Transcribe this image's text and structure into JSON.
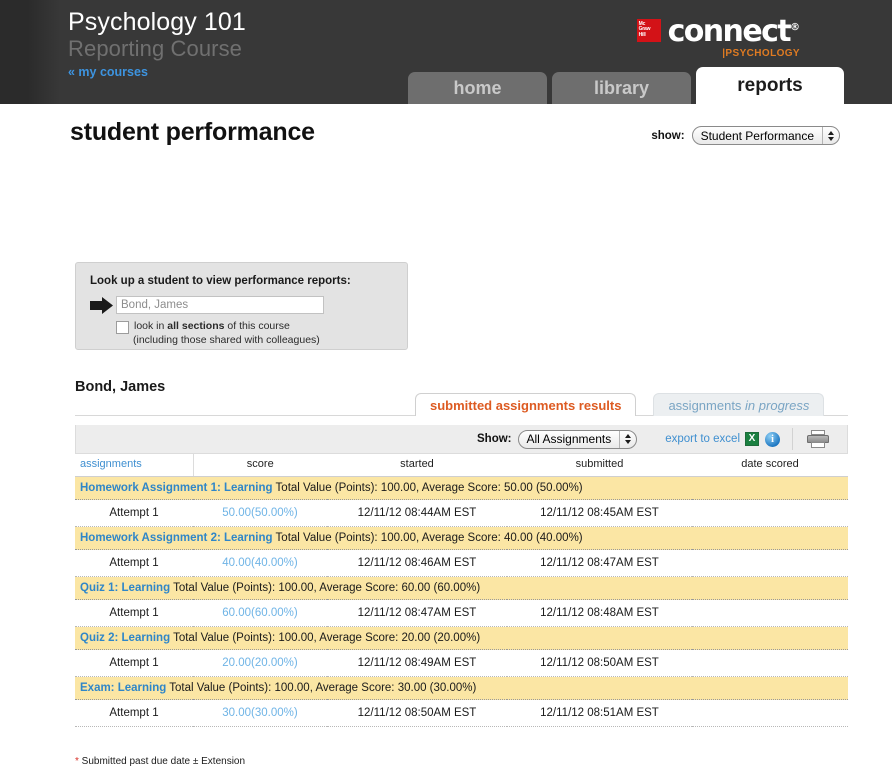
{
  "header": {
    "course_title": "Psychology 101",
    "course_subtitle": "Reporting Course",
    "my_courses_link": "« my courses",
    "brand": {
      "publisher_line1": "Mc",
      "publisher_line2": "Graw",
      "publisher_line3": "Hill",
      "name": "connect",
      "trademark": "®",
      "discipline": "|PSYCHOLOGY"
    },
    "tabs": [
      {
        "label": "home",
        "active": false
      },
      {
        "label": "library",
        "active": false
      },
      {
        "label": "reports",
        "active": true
      }
    ]
  },
  "page": {
    "title": "student performance",
    "show_label": "show:",
    "show_value": "Student Performance"
  },
  "lookup": {
    "title": "Look up a student to view performance reports:",
    "input_placeholder": "Bond, James",
    "input_value": "",
    "arrow_icon": "arrow-right-icon",
    "checkbox_checked": false,
    "checkbox_text_before": "look in ",
    "checkbox_text_bold": "all sections",
    "checkbox_text_after": " of this course",
    "checkbox_subtext": "(including those shared with colleagues)"
  },
  "student": {
    "name": "Bond, James"
  },
  "result_tabs": [
    {
      "label": "submitted assignments results",
      "active": true
    },
    {
      "label_prefix": "assignments ",
      "label_italic": "in progress",
      "active": false
    }
  ],
  "toolbar": {
    "show_label": "Show:",
    "show_value": "All Assignments",
    "export_label": "export to excel",
    "excel_icon": "excel-icon",
    "excel_icon_glyph": "X",
    "info_icon": "info-icon",
    "info_icon_glyph": "i",
    "print_icon": "printer-icon"
  },
  "table": {
    "columns": [
      "assignments",
      "score",
      "started",
      "submitted",
      "date scored"
    ],
    "rows": [
      {
        "assignment": "Homework Assignment 1: Learning",
        "summary": " Total Value (Points): 100.00, Average Score: 50.00 (50.00%)",
        "attempts": [
          {
            "attempt": "Attempt 1",
            "score": "50.00(50.00%)",
            "started": "12/11/12 08:44AM EST",
            "submitted": "12/11/12 08:45AM EST",
            "date_scored": ""
          }
        ]
      },
      {
        "assignment": "Homework Assignment 2: Learning",
        "summary": " Total Value (Points): 100.00, Average Score: 40.00 (40.00%)",
        "attempts": [
          {
            "attempt": "Attempt 1",
            "score": "40.00(40.00%)",
            "started": "12/11/12 08:46AM EST",
            "submitted": "12/11/12 08:47AM EST",
            "date_scored": ""
          }
        ]
      },
      {
        "assignment": "Quiz 1: Learning",
        "summary": " Total Value (Points): 100.00, Average Score: 60.00 (60.00%)",
        "attempts": [
          {
            "attempt": "Attempt 1",
            "score": "60.00(60.00%)",
            "started": "12/11/12 08:47AM EST",
            "submitted": "12/11/12 08:48AM EST",
            "date_scored": ""
          }
        ]
      },
      {
        "assignment": "Quiz 2: Learning",
        "summary": " Total Value (Points): 100.00, Average Score: 20.00 (20.00%)",
        "attempts": [
          {
            "attempt": "Attempt 1",
            "score": "20.00(20.00%)",
            "started": "12/11/12 08:49AM EST",
            "submitted": "12/11/12 08:50AM EST",
            "date_scored": ""
          }
        ]
      },
      {
        "assignment": "Exam: Learning",
        "summary": " Total Value (Points): 100.00, Average Score: 30.00 (30.00%)",
        "attempts": [
          {
            "attempt": "Attempt 1",
            "score": "30.00(30.00%)",
            "started": "12/11/12 08:50AM EST",
            "submitted": "12/11/12 08:51AM EST",
            "date_scored": ""
          }
        ]
      }
    ]
  },
  "footnote": {
    "star": "*",
    "text": " Submitted past due date ± Extension"
  },
  "colors": {
    "header_bg": "#383838",
    "accent_orange": "#dd5b22",
    "link_blue": "#3f8fd0",
    "row_yellow": "#fbe6a4",
    "brand_red": "#d31217",
    "discipline_orange": "#e07b22"
  }
}
